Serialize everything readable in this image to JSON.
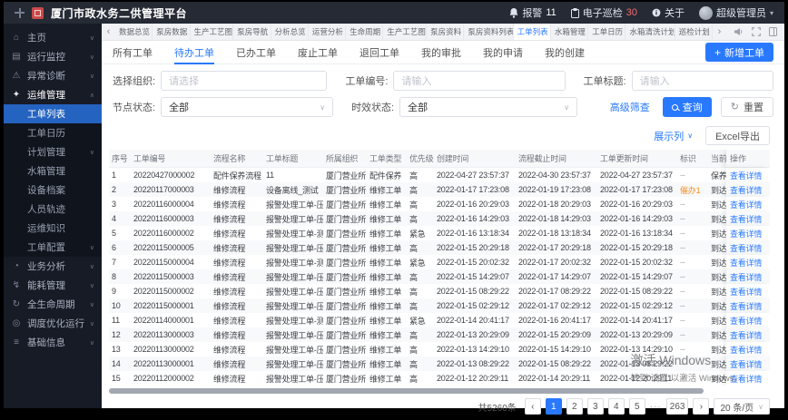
{
  "header": {
    "title": "厦门市政水务二供管理平台",
    "alarm_label": "报警",
    "alarm_count": "11",
    "inspection_label": "电子巡检",
    "inspection_count": "30",
    "about_label": "关于",
    "user_name": "超级管理员"
  },
  "sidebar": {
    "items": [
      {
        "label": "主页",
        "icon": "home-icon",
        "type": "parent",
        "chevron": "down"
      },
      {
        "label": "运行监控",
        "icon": "monitor-icon",
        "type": "parent",
        "chevron": "down"
      },
      {
        "label": "异常诊断",
        "icon": "diagnosis-icon",
        "type": "parent",
        "chevron": "down"
      },
      {
        "label": "运维管理",
        "icon": "ops-icon",
        "type": "parent",
        "chevron": "up",
        "active": true
      },
      {
        "label": "工单列表",
        "type": "child",
        "active": true
      },
      {
        "label": "工单日历",
        "type": "child"
      },
      {
        "label": "计划管理",
        "type": "child",
        "chevron": "down"
      },
      {
        "label": "水箱管理",
        "type": "child"
      },
      {
        "label": "设备档案",
        "type": "child"
      },
      {
        "label": "人员轨迹",
        "type": "child"
      },
      {
        "label": "运维知识",
        "type": "child"
      },
      {
        "label": "工单配置",
        "type": "child",
        "chevron": "down"
      },
      {
        "label": "业务分析",
        "icon": "analysis-icon",
        "type": "parent",
        "chevron": "down"
      },
      {
        "label": "能耗管理",
        "icon": "energy-icon",
        "type": "parent",
        "chevron": "down"
      },
      {
        "label": "全生命周期",
        "icon": "lifecycle-icon",
        "type": "parent",
        "chevron": "down"
      },
      {
        "label": "调度优化运行",
        "icon": "dispatch-icon",
        "type": "parent",
        "chevron": "down"
      },
      {
        "label": "基础信息",
        "icon": "info-icon",
        "type": "parent",
        "chevron": "down"
      }
    ]
  },
  "tabbar": {
    "left_arrow": "‹",
    "right_arrow": "›",
    "active_index": 10,
    "tabs": [
      "数据总览",
      "泵房数据",
      "生产工艺图",
      "泵房导航",
      "分析总览",
      "运营分析",
      "生命周期",
      "生产工艺图",
      "泵房资料",
      "泵房资料列表",
      "工单列表",
      "水箱管理",
      "工单日历",
      "水箱清洗计划",
      "巡检计划"
    ]
  },
  "subtabs": {
    "active_index": 1,
    "items": [
      "所有工单",
      "待办工单",
      "已办工单",
      "废止工单",
      "退回工单",
      "我的审批",
      "我的申请",
      "我的创建"
    ],
    "new_button": "新增工单"
  },
  "filters": {
    "org_label": "选择组织:",
    "org_placeholder": "请选择",
    "code_label": "工单编号:",
    "code_placeholder": "请输入",
    "title_label": "工单标题:",
    "title_placeholder": "请输入",
    "node_label": "节点状态:",
    "node_value": "全部",
    "time_label": "时效状态:",
    "time_value": "全部",
    "advanced_link": "高级筛查",
    "search_button": "查询",
    "reset_button": "重置"
  },
  "toolbar": {
    "columns_link": "展示列",
    "excel_button": "Excel导出"
  },
  "table": {
    "headers": [
      "序号",
      "工单编号",
      "流程名称",
      "工单标题",
      "所属组织",
      "工单类型",
      "优先级",
      "创建时间",
      "流程截止时间",
      "工单更新时间",
      "标识",
      "当前处理人",
      "操作"
    ],
    "action_label": "查看详情",
    "rows": [
      [
        "1",
        "20220427000002",
        "配件保养流程",
        "11",
        "厦门营业所",
        "配件保养",
        "高",
        "2022-04-27 23:57:37",
        "2022-04-30 23:57:37",
        "2022-04-27 23:57:37",
        "--",
        "保养"
      ],
      [
        "2",
        "20220117000003",
        "维修流程",
        "设备离线_测试",
        "厦门营业所",
        "维修工单",
        "高",
        "2022-01-17 17:23:08",
        "2022-01-19 17:23:08",
        "2022-01-17 17:23:08",
        "催办1",
        "到达"
      ],
      [
        "3",
        "20220116000004",
        "维修流程",
        "报警处理工单-压力异...",
        "厦门营业所",
        "维修工单",
        "高",
        "2022-01-16 20:29:03",
        "2022-01-18 20:29:03",
        "2022-01-16 20:29:03",
        "--",
        "到达"
      ],
      [
        "4",
        "20220116000003",
        "维修流程",
        "报警处理工单-压力异...",
        "厦门营业所",
        "维修工单",
        "高",
        "2022-01-16 14:29:03",
        "2022-01-18 14:29:03",
        "2022-01-16 14:29:03",
        "--",
        "到达"
      ],
      [
        "5",
        "20220116000002",
        "维修流程",
        "报警处理工单-测试进...",
        "厦门营业所",
        "维修工单",
        "紧急",
        "2022-01-16 13:18:34",
        "2022-01-18 13:18:34",
        "2022-01-16 13:18:34",
        "--",
        "到达"
      ],
      [
        "6",
        "20220115000005",
        "维修流程",
        "报警处理工单-压力异...",
        "厦门营业所",
        "维修工单",
        "高",
        "2022-01-15 20:29:18",
        "2022-01-17 20:29:18",
        "2022-01-15 20:29:18",
        "--",
        "到达"
      ],
      [
        "7",
        "20220115000004",
        "维修流程",
        "报警处理工单-测试进...",
        "厦门营业所",
        "维修工单",
        "紧急",
        "2022-01-15 20:02:32",
        "2022-01-17 20:02:32",
        "2022-01-15 20:02:32",
        "--",
        "到达"
      ],
      [
        "8",
        "20220115000003",
        "维修流程",
        "报警处理工单-压力异...",
        "厦门营业所",
        "维修工单",
        "高",
        "2022-01-15 14:29:07",
        "2022-01-17 14:29:07",
        "2022-01-15 14:29:07",
        "--",
        "到达"
      ],
      [
        "9",
        "20220115000002",
        "维修流程",
        "报警处理工单-压力异...",
        "厦门营业所",
        "维修工单",
        "高",
        "2022-01-15 08:29:22",
        "2022-01-17 08:29:22",
        "2022-01-15 08:29:22",
        "--",
        "到达"
      ],
      [
        "10",
        "20220115000001",
        "维修流程",
        "报警处理工单-压力异...",
        "厦门营业所",
        "维修工单",
        "高",
        "2022-01-15 02:29:12",
        "2022-01-17 02:29:12",
        "2022-01-15 02:29:12",
        "--",
        "到达"
      ],
      [
        "11",
        "20220114000001",
        "维修流程",
        "报警处理工单-测试进...",
        "厦门营业所",
        "维修工单",
        "紧急",
        "2022-01-14 20:41:17",
        "2022-01-16 20:41:17",
        "2022-01-14 20:41:17",
        "--",
        "到达"
      ],
      [
        "12",
        "20220113000003",
        "维修流程",
        "报警处理工单-压力异...",
        "厦门营业所",
        "维修工单",
        "高",
        "2022-01-13 20:29:09",
        "2022-01-15 20:29:09",
        "2022-01-13 20:29:09",
        "--",
        "到达"
      ],
      [
        "13",
        "20220113000002",
        "维修流程",
        "报警处理工单-压力异...",
        "厦门营业所",
        "维修工单",
        "高",
        "2022-01-13 14:29:10",
        "2022-01-15 14:29:10",
        "2022-01-13 14:29:10",
        "--",
        "到达"
      ],
      [
        "14",
        "20220113000001",
        "维修流程",
        "报警处理工单-压力异...",
        "厦门营业所",
        "维修工单",
        "高",
        "2022-01-13 08:29:22",
        "2022-01-15 08:29:22",
        "2022-01-13 08:29:22",
        "--",
        "到达"
      ],
      [
        "15",
        "20220112000002",
        "维修流程",
        "报警处理工单-压力异...",
        "厦门营业所",
        "维修工单",
        "高",
        "2022-01-12 20:29:11",
        "2022-01-14 20:29:11",
        "2022-01-12 20:29:11",
        "--",
        "到达"
      ]
    ]
  },
  "pagination": {
    "total": "共5260条",
    "prev": "‹",
    "next": "›",
    "pages": [
      "1",
      "2",
      "3",
      "4",
      "5"
    ],
    "active_page": "1",
    "ellipsis": "···",
    "last_page": "263",
    "page_size": "20 条/页"
  },
  "watermark": {
    "line1": "激活 Windows",
    "line2": "转到“设置”以激活 Windows。"
  },
  "colors": {
    "accent": "#2979ff",
    "sidebar_active": "#2563c0",
    "mark_orange": "#fa8c16"
  }
}
